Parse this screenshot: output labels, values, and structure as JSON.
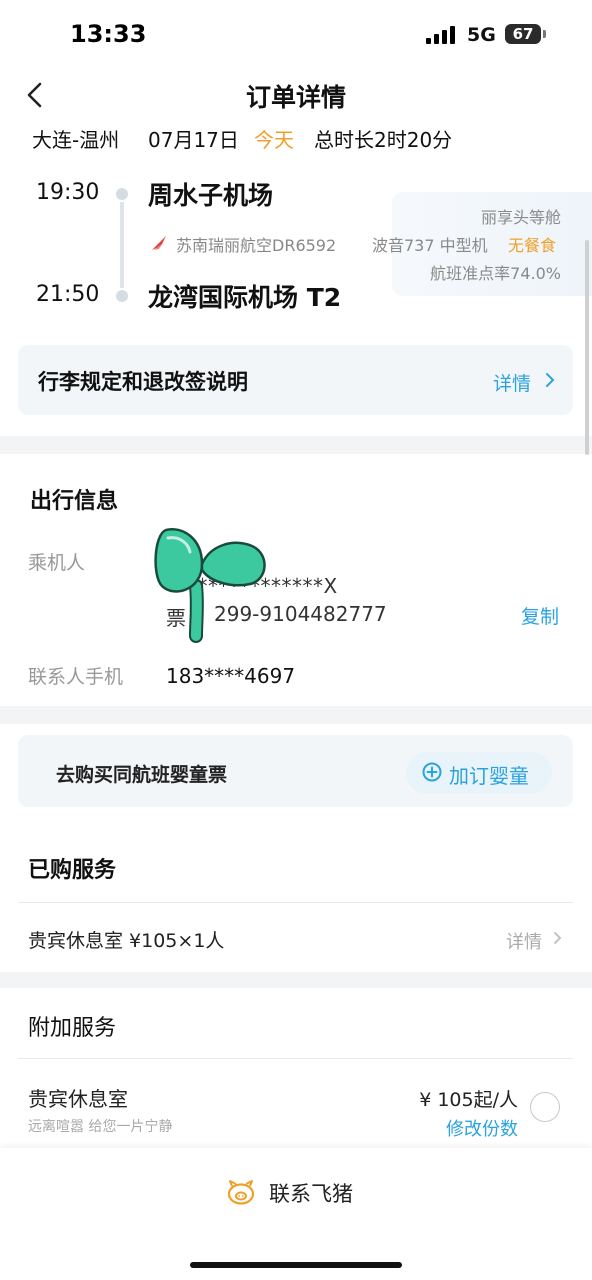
{
  "status_bar": {
    "time": "13:33",
    "network": "5G",
    "battery": "67"
  },
  "header": {
    "title": "订单详情"
  },
  "flight": {
    "route": "大连-温州",
    "date": "07月17日",
    "today": "今天",
    "duration": "总时长2时20分",
    "departure": {
      "time": "19:30",
      "airport": "周水子机场"
    },
    "arrival": {
      "time": "21:50",
      "airport": "龙湾国际机场 T2"
    },
    "airline": "苏南瑞丽航空DR6592",
    "cabin": "丽享头等舱",
    "aircraft": "波音737 中型机",
    "meal": "无餐食",
    "on_time_rate": "航班准点率74.0%"
  },
  "rules": {
    "title": "行李规定和退改签说明",
    "link": "详情"
  },
  "travel_info": {
    "title": "出行信息",
    "passenger_label": "乘机人",
    "passenger_id": "***************X",
    "ticket_prefix": "票",
    "ticket_number": "299-9104482777",
    "copy_label": "复制",
    "contact_label": "联系人手机",
    "contact_phone": "183****4697"
  },
  "infant": {
    "text": "去购买同航班婴童票",
    "button": "加订婴童"
  },
  "purchased": {
    "title": "已购服务",
    "item": "贵宾休息室 ¥105×1人",
    "link": "详情"
  },
  "addon": {
    "title": "附加服务",
    "name": "贵宾休息室",
    "desc": "远离喧嚣 给您一片宁静",
    "price": "¥ 105起/人",
    "edit": "修改份数"
  },
  "footer": {
    "contact": "联系飞猪"
  },
  "colors": {
    "accent_blue": "#2aa3df",
    "accent_orange": "#f0a02a",
    "cover_green": "#3cc9a0"
  }
}
